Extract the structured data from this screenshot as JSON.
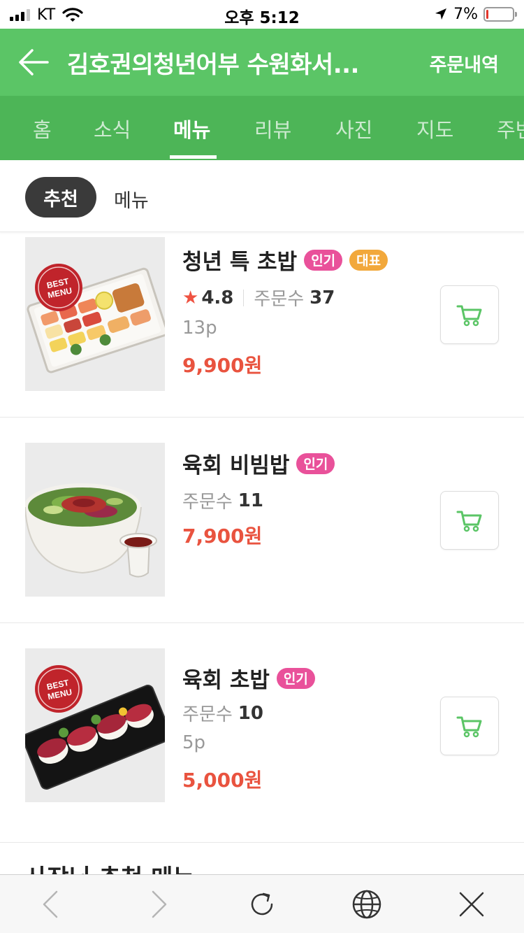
{
  "status_bar": {
    "carrier": "KT",
    "time": "오후 5:12",
    "battery_percent": "7%",
    "battery_level": 0.07,
    "battery_color": "#e3352b"
  },
  "header": {
    "title": "김호권의청년어부 수원화서...",
    "order_history": "주문내역",
    "background": "#5bc566"
  },
  "tabs": [
    {
      "label": "홈",
      "active": false
    },
    {
      "label": "소식",
      "active": false
    },
    {
      "label": "메뉴",
      "active": true
    },
    {
      "label": "리뷰",
      "active": false
    },
    {
      "label": "사진",
      "active": false
    },
    {
      "label": "지도",
      "active": false
    },
    {
      "label": "주변",
      "active": false
    }
  ],
  "subtabs": {
    "recommended": "추천",
    "menu": "메뉴"
  },
  "menu_items": [
    {
      "name": "청년 특 초밥",
      "badges": [
        "인기",
        "대표"
      ],
      "rating": "4.8",
      "orders_label": "주문수",
      "orders": "37",
      "portion": "13p",
      "price": "9,900원",
      "best_badge": [
        "BEST",
        "MENU"
      ]
    },
    {
      "name": "육회 비빔밥",
      "badges": [
        "인기"
      ],
      "orders_label": "주문수",
      "orders": "11",
      "price": "7,900원"
    },
    {
      "name": "육회 초밥",
      "badges": [
        "인기"
      ],
      "orders_label": "주문수",
      "orders": "10",
      "portion": "5p",
      "price": "5,000원",
      "best_badge": [
        "BEST",
        "MENU"
      ]
    }
  ],
  "section_title": "사장님 추천 메뉴",
  "colors": {
    "accent_green": "#5bc566",
    "price_red": "#e9533f",
    "badge_popular": "#e9519a",
    "badge_signature": "#f2a83b",
    "cart_icon": "#5bc566"
  },
  "icons": {
    "back": "arrow-left-icon",
    "cart": "cart-icon",
    "star": "star-icon",
    "toolbar": [
      "chevron-left-icon",
      "chevron-right-icon",
      "reload-icon",
      "globe-icon",
      "close-icon"
    ]
  }
}
